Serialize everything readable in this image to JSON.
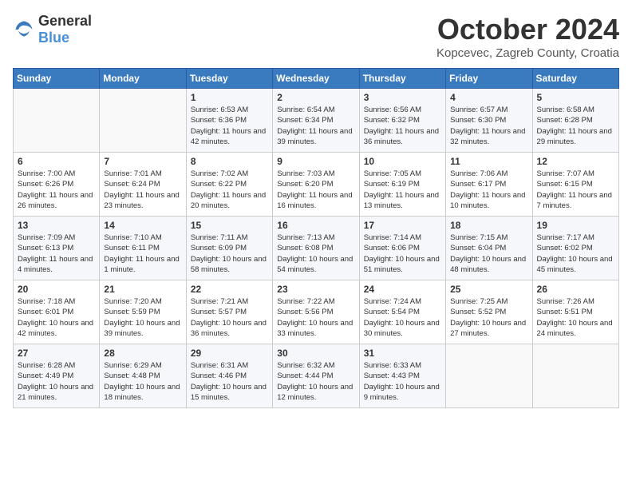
{
  "header": {
    "logo_general": "General",
    "logo_blue": "Blue",
    "title": "October 2024",
    "subtitle": "Kopcevec, Zagreb County, Croatia"
  },
  "days_of_week": [
    "Sunday",
    "Monday",
    "Tuesday",
    "Wednesday",
    "Thursday",
    "Friday",
    "Saturday"
  ],
  "weeks": [
    [
      {
        "day": "",
        "info": ""
      },
      {
        "day": "",
        "info": ""
      },
      {
        "day": "1",
        "info": "Sunrise: 6:53 AM\nSunset: 6:36 PM\nDaylight: 11 hours and 42 minutes."
      },
      {
        "day": "2",
        "info": "Sunrise: 6:54 AM\nSunset: 6:34 PM\nDaylight: 11 hours and 39 minutes."
      },
      {
        "day": "3",
        "info": "Sunrise: 6:56 AM\nSunset: 6:32 PM\nDaylight: 11 hours and 36 minutes."
      },
      {
        "day": "4",
        "info": "Sunrise: 6:57 AM\nSunset: 6:30 PM\nDaylight: 11 hours and 32 minutes."
      },
      {
        "day": "5",
        "info": "Sunrise: 6:58 AM\nSunset: 6:28 PM\nDaylight: 11 hours and 29 minutes."
      }
    ],
    [
      {
        "day": "6",
        "info": "Sunrise: 7:00 AM\nSunset: 6:26 PM\nDaylight: 11 hours and 26 minutes."
      },
      {
        "day": "7",
        "info": "Sunrise: 7:01 AM\nSunset: 6:24 PM\nDaylight: 11 hours and 23 minutes."
      },
      {
        "day": "8",
        "info": "Sunrise: 7:02 AM\nSunset: 6:22 PM\nDaylight: 11 hours and 20 minutes."
      },
      {
        "day": "9",
        "info": "Sunrise: 7:03 AM\nSunset: 6:20 PM\nDaylight: 11 hours and 16 minutes."
      },
      {
        "day": "10",
        "info": "Sunrise: 7:05 AM\nSunset: 6:19 PM\nDaylight: 11 hours and 13 minutes."
      },
      {
        "day": "11",
        "info": "Sunrise: 7:06 AM\nSunset: 6:17 PM\nDaylight: 11 hours and 10 minutes."
      },
      {
        "day": "12",
        "info": "Sunrise: 7:07 AM\nSunset: 6:15 PM\nDaylight: 11 hours and 7 minutes."
      }
    ],
    [
      {
        "day": "13",
        "info": "Sunrise: 7:09 AM\nSunset: 6:13 PM\nDaylight: 11 hours and 4 minutes."
      },
      {
        "day": "14",
        "info": "Sunrise: 7:10 AM\nSunset: 6:11 PM\nDaylight: 11 hours and 1 minute."
      },
      {
        "day": "15",
        "info": "Sunrise: 7:11 AM\nSunset: 6:09 PM\nDaylight: 10 hours and 58 minutes."
      },
      {
        "day": "16",
        "info": "Sunrise: 7:13 AM\nSunset: 6:08 PM\nDaylight: 10 hours and 54 minutes."
      },
      {
        "day": "17",
        "info": "Sunrise: 7:14 AM\nSunset: 6:06 PM\nDaylight: 10 hours and 51 minutes."
      },
      {
        "day": "18",
        "info": "Sunrise: 7:15 AM\nSunset: 6:04 PM\nDaylight: 10 hours and 48 minutes."
      },
      {
        "day": "19",
        "info": "Sunrise: 7:17 AM\nSunset: 6:02 PM\nDaylight: 10 hours and 45 minutes."
      }
    ],
    [
      {
        "day": "20",
        "info": "Sunrise: 7:18 AM\nSunset: 6:01 PM\nDaylight: 10 hours and 42 minutes."
      },
      {
        "day": "21",
        "info": "Sunrise: 7:20 AM\nSunset: 5:59 PM\nDaylight: 10 hours and 39 minutes."
      },
      {
        "day": "22",
        "info": "Sunrise: 7:21 AM\nSunset: 5:57 PM\nDaylight: 10 hours and 36 minutes."
      },
      {
        "day": "23",
        "info": "Sunrise: 7:22 AM\nSunset: 5:56 PM\nDaylight: 10 hours and 33 minutes."
      },
      {
        "day": "24",
        "info": "Sunrise: 7:24 AM\nSunset: 5:54 PM\nDaylight: 10 hours and 30 minutes."
      },
      {
        "day": "25",
        "info": "Sunrise: 7:25 AM\nSunset: 5:52 PM\nDaylight: 10 hours and 27 minutes."
      },
      {
        "day": "26",
        "info": "Sunrise: 7:26 AM\nSunset: 5:51 PM\nDaylight: 10 hours and 24 minutes."
      }
    ],
    [
      {
        "day": "27",
        "info": "Sunrise: 6:28 AM\nSunset: 4:49 PM\nDaylight: 10 hours and 21 minutes."
      },
      {
        "day": "28",
        "info": "Sunrise: 6:29 AM\nSunset: 4:48 PM\nDaylight: 10 hours and 18 minutes."
      },
      {
        "day": "29",
        "info": "Sunrise: 6:31 AM\nSunset: 4:46 PM\nDaylight: 10 hours and 15 minutes."
      },
      {
        "day": "30",
        "info": "Sunrise: 6:32 AM\nSunset: 4:44 PM\nDaylight: 10 hours and 12 minutes."
      },
      {
        "day": "31",
        "info": "Sunrise: 6:33 AM\nSunset: 4:43 PM\nDaylight: 10 hours and 9 minutes."
      },
      {
        "day": "",
        "info": ""
      },
      {
        "day": "",
        "info": ""
      }
    ]
  ]
}
